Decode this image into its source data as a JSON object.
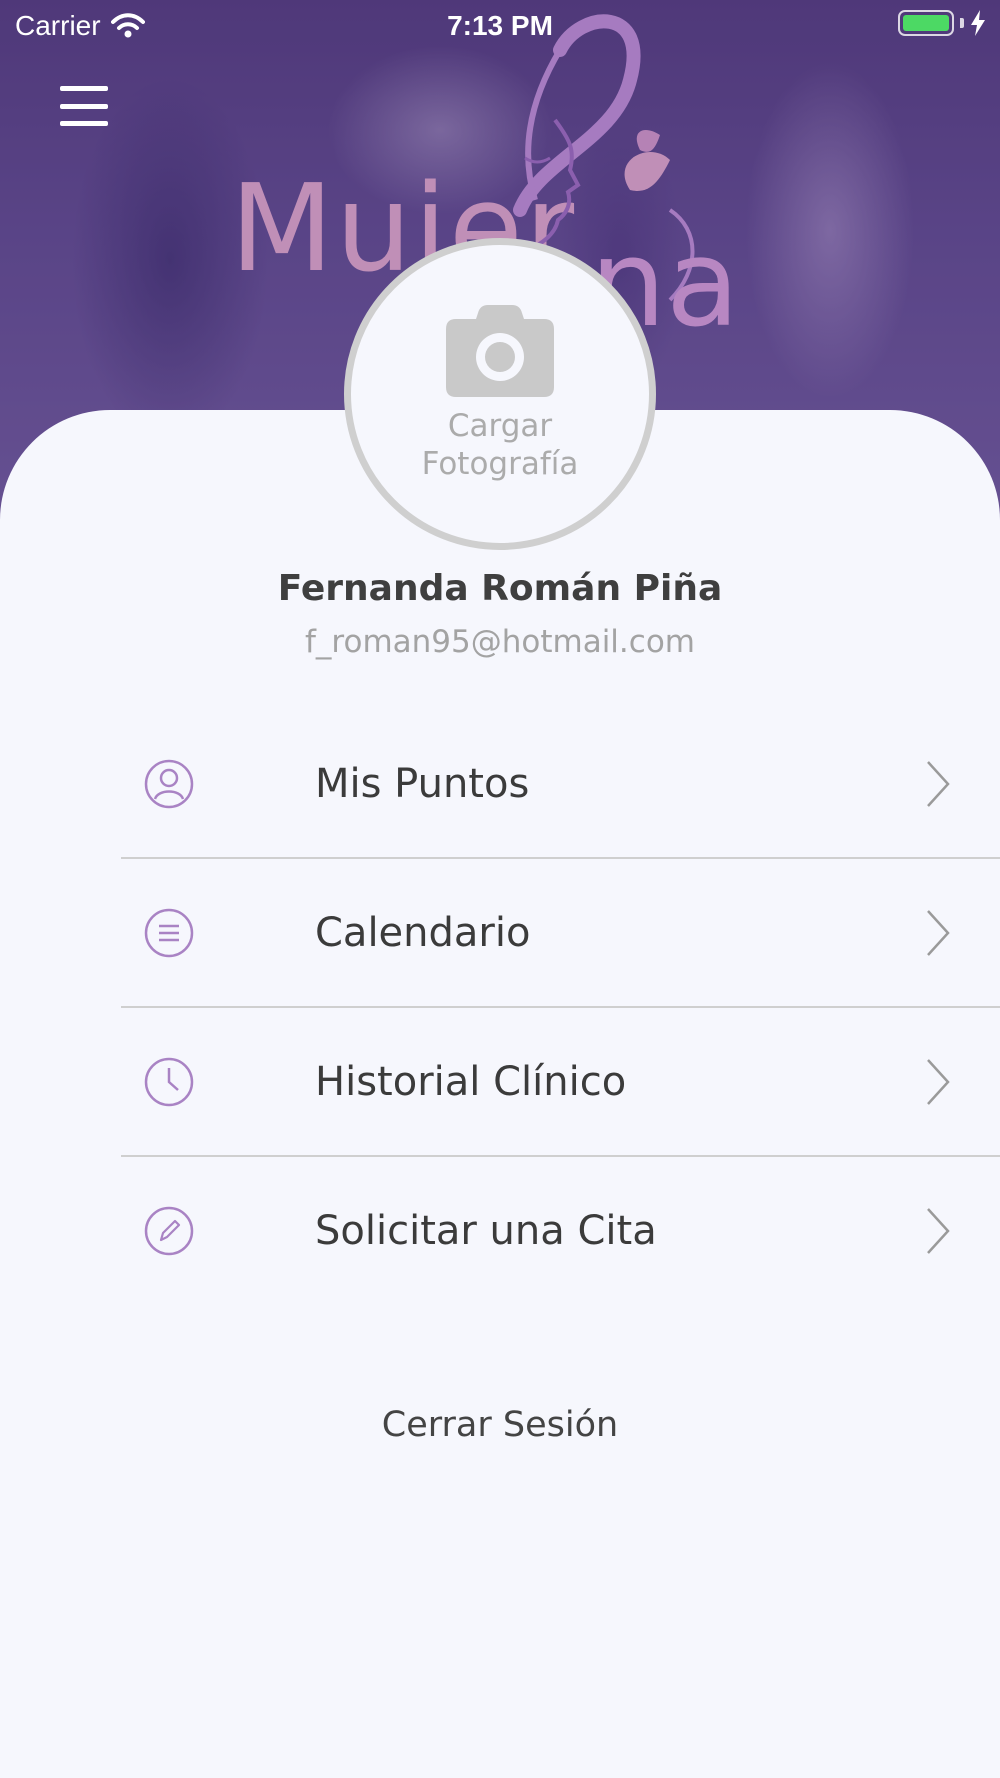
{
  "status_bar": {
    "carrier": "Carrier",
    "time": "7:13 PM",
    "icons": [
      "wifi-icon",
      "battery-icon",
      "charging-bolt-icon"
    ]
  },
  "header": {
    "logo_text": "Mujer",
    "menu_icon": "hamburger-icon"
  },
  "profile": {
    "photo_label_line1": "Cargar",
    "photo_label_line2": "Fotografía",
    "name": "Fernanda Román Piña",
    "email": "f_roman95@hotmail.com",
    "camera_icon": "camera-icon"
  },
  "menu": {
    "items": [
      {
        "label": "Mis Puntos",
        "icon": "user-circle-icon"
      },
      {
        "label": "Calendario",
        "icon": "list-circle-icon"
      },
      {
        "label": "Historial Clínico",
        "icon": "clock-icon"
      },
      {
        "label": "Solicitar una Cita",
        "icon": "pencil-icon"
      }
    ]
  },
  "logout_label": "Cerrar Sesión",
  "colors": {
    "accent": "#a983c4",
    "card_bg": "#f6f7fd",
    "logo": "#c08fb7",
    "battery": "#4cd964"
  }
}
